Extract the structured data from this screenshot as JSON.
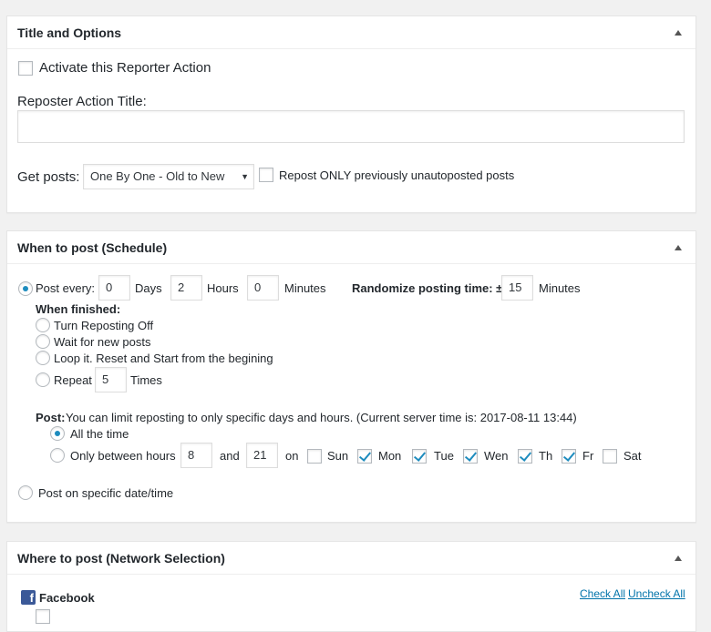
{
  "title_options": {
    "header": "Title and Options",
    "activate_label": "Activate this Reporter Action",
    "action_title_label": "Reposter Action Title:",
    "action_title_value": "",
    "get_posts_label": "Get posts:",
    "get_posts_selected": "One By One - Old to New",
    "repost_only_label": "Repost ONLY previously unautoposted posts"
  },
  "schedule": {
    "header": "When to post (Schedule)",
    "post_every_label": "Post every:",
    "days_value": "0",
    "days_label": "Days",
    "hours_value": "2",
    "hours_label": "Hours",
    "minutes_value": "0",
    "minutes_label": "Minutes",
    "randomize_label": "Randomize posting time: ±",
    "randomize_value": "15",
    "randomize_unit": "Minutes",
    "when_finished_label": "When finished:",
    "finished_options": [
      "Turn Reposting Off",
      "Wait for new posts",
      "Loop it. Reset and Start from the begining"
    ],
    "repeat_label": "Repeat",
    "repeat_value": "5",
    "repeat_unit": "Times",
    "post_label": "Post:",
    "limit_text": "You can limit reposting to only specific days and hours. (Current server time is: 2017-08-11 13:44)",
    "all_time_label": "All the time",
    "only_between_label": "Only between hours",
    "hour_from": "8",
    "and_label": "and",
    "hour_to": "21",
    "on_label": "on",
    "days": [
      {
        "label": "Sun",
        "checked": false
      },
      {
        "label": "Mon",
        "checked": true
      },
      {
        "label": "Tue",
        "checked": true
      },
      {
        "label": "Wen",
        "checked": true
      },
      {
        "label": "Th",
        "checked": true
      },
      {
        "label": "Fr",
        "checked": true
      },
      {
        "label": "Sat",
        "checked": false
      }
    ],
    "specific_date_label": "Post on specific date/time"
  },
  "network": {
    "header": "Where to post (Network Selection)",
    "facebook_label": "Facebook",
    "check_all": "Check All",
    "uncheck_all": "Uncheck All"
  },
  "colors": {
    "accent": "#1e8cbe",
    "link": "#0073aa",
    "facebook": "#3b5998"
  }
}
